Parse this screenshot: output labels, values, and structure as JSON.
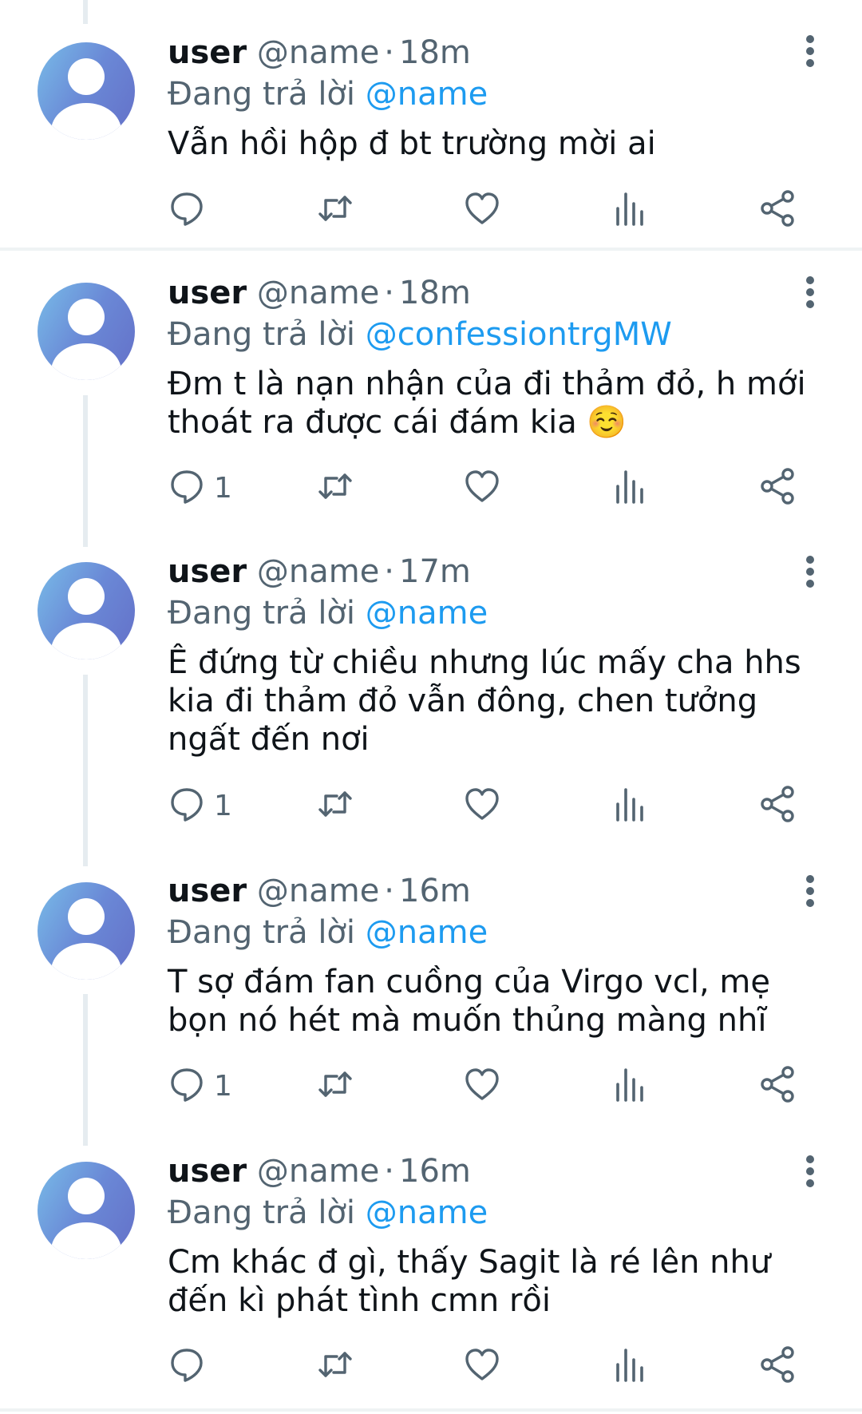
{
  "tweets": [
    {
      "username": "user",
      "handle": "@name",
      "dot": "·",
      "time": "18m",
      "reply_prefix": "Đang trả lời",
      "reply_to": "@name",
      "text": "Vẫn hồi hộp đ bt trường mời ai",
      "reply_count": ""
    },
    {
      "username": "user",
      "handle": "@name",
      "dot": "·",
      "time": "18m",
      "reply_prefix": "Đang trả lời",
      "reply_to": "@confessiontrgMW",
      "text": "Đm t là nạn nhận của đi thảm đỏ, h mới thoát ra được cái đám kia ☺️",
      "reply_count": "1"
    },
    {
      "username": "user",
      "handle": "@name",
      "dot": "·",
      "time": "17m",
      "reply_prefix": "Đang trả lời",
      "reply_to": "@name",
      "text": "Ê đứng từ chiều nhưng lúc mấy cha hhs kia đi thảm đỏ vẫn đông, chen tưởng ngất đến nơi",
      "reply_count": "1"
    },
    {
      "username": "user",
      "handle": "@name",
      "dot": "·",
      "time": "16m",
      "reply_prefix": "Đang trả lời",
      "reply_to": "@name",
      "text": "T sợ đám fan cuồng của Virgo vcl, mẹ bọn nó hét mà muốn thủng màng nhĩ",
      "reply_count": "1"
    },
    {
      "username": "user",
      "handle": "@name",
      "dot": "·",
      "time": "16m",
      "reply_prefix": "Đang trả lời",
      "reply_to": "@name",
      "text": "Cm khác đ gì, thấy Sagit là ré lên như đến kì phát tình cmn rồi",
      "reply_count": ""
    }
  ],
  "icons": {
    "reply": "speech-bubble-icon",
    "retweet": "retweet-icon",
    "like": "heart-icon",
    "views": "bar-chart-icon",
    "share": "share-icon",
    "more": "more-vertical-icon"
  },
  "colors": {
    "text": "#0f1419",
    "secondary": "#536471",
    "mention": "#1d9bf0",
    "thread_line": "#e6ecf0",
    "divider": "#eff3f4"
  }
}
